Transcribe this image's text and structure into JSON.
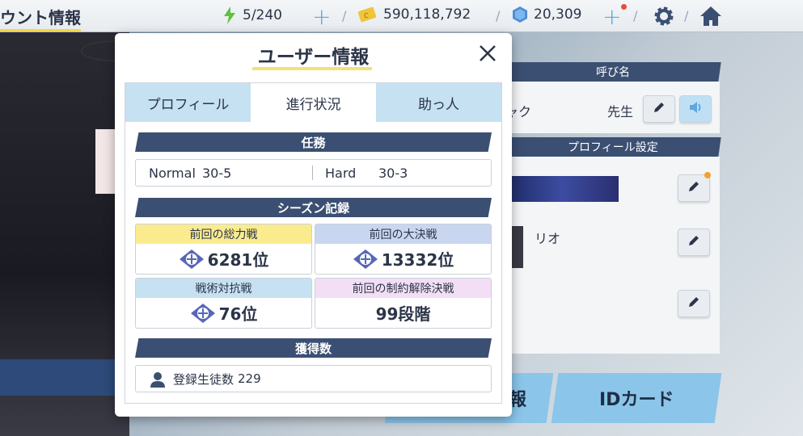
{
  "topbar": {
    "title": "ウント情報",
    "ap": "5/240",
    "credits": "590,118,792",
    "gems": "20,309",
    "icons": [
      "lightning-icon",
      "credit-icon",
      "gem-icon",
      "gear-icon",
      "home-icon"
    ]
  },
  "right_panel": {
    "nickname_header": "呼び名",
    "nickname_value": "ャク",
    "honorific": "先生",
    "profile_settings_header": "プロフィール設定",
    "assistant_name": "リオ"
  },
  "bottom_buttons": {
    "left_partial": "報",
    "id_card": "IDカード"
  },
  "modal": {
    "title": "ユーザー情報",
    "tabs": [
      {
        "label": "プロフィール",
        "active": false
      },
      {
        "label": "進行状況",
        "active": true
      },
      {
        "label": "助っ人",
        "active": false
      }
    ],
    "missions": {
      "header": "任務",
      "normal_label": "Normal",
      "normal_value": "30-5",
      "hard_label": "Hard",
      "hard_value": "30-3"
    },
    "season": {
      "header": "シーズン記録",
      "records": [
        {
          "label": "前回の総力戦",
          "value": "6281位",
          "color": "#faeb8f"
        },
        {
          "label": "前回の大決戦",
          "value": "13332位",
          "color": "#c9d6f0"
        },
        {
          "label": "戦術対抗戦",
          "value": "76位",
          "color": "#c6e1f2"
        },
        {
          "label": "前回の制約解除決戦",
          "value": "99段階",
          "color": "#f3dff5"
        }
      ]
    },
    "acquired": {
      "header": "獲得数",
      "students_label": "登録生徒数",
      "students_value": "229"
    }
  }
}
